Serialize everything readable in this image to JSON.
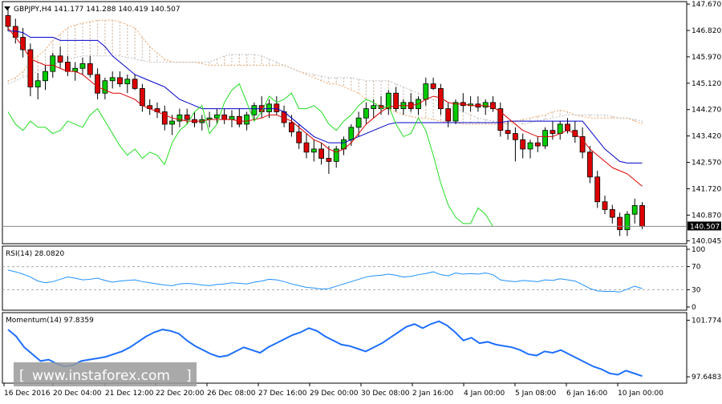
{
  "chart_data": {
    "type": "candlestick",
    "symbol_header": "GBPJPY,H4  141.177 141.288 140.419 140.507",
    "price_axis": {
      "ticks": [
        "147.670",
        "146.820",
        "145.970",
        "145.120",
        "144.270",
        "143.420",
        "142.570",
        "141.720",
        "140.870",
        "140.045"
      ],
      "current_price": "140.507",
      "ylim": [
        139.95,
        147.75
      ]
    },
    "x_labels": [
      "16 Dec 2016",
      "20 Dec 04:00",
      "21 Dec 12:00",
      "22 Dec 20:00",
      "26 Dec 08:00",
      "27 Dec 16:00",
      "29 Dec 00:00",
      "30 Dec 08:00",
      "2 Jan 16:00",
      "4 Jan 00:00",
      "5 Jan 08:00",
      "6 Jan 16:00",
      "10 Jan 00:00"
    ],
    "candles": [
      [
        147.3,
        147.55,
        146.8,
        146.95
      ],
      [
        146.95,
        147.2,
        146.4,
        146.6
      ],
      [
        146.6,
        146.9,
        145.95,
        146.2
      ],
      [
        146.2,
        146.4,
        144.7,
        145.0
      ],
      [
        145.0,
        145.45,
        144.6,
        145.2
      ],
      [
        145.2,
        145.7,
        144.9,
        145.5
      ],
      [
        145.5,
        146.1,
        145.3,
        146.0
      ],
      [
        146.0,
        146.3,
        145.6,
        145.8
      ],
      [
        145.8,
        146.0,
        145.35,
        145.5
      ],
      [
        145.5,
        145.8,
        145.2,
        145.6
      ],
      [
        145.6,
        145.95,
        145.4,
        145.75
      ],
      [
        145.75,
        146.0,
        145.3,
        145.4
      ],
      [
        145.4,
        145.6,
        144.6,
        144.8
      ],
      [
        144.8,
        145.3,
        144.6,
        145.2
      ],
      [
        145.2,
        145.5,
        144.95,
        145.3
      ],
      [
        145.3,
        145.5,
        145.0,
        145.1
      ],
      [
        145.1,
        145.4,
        144.8,
        145.25
      ],
      [
        145.25,
        145.4,
        144.9,
        144.95
      ],
      [
        144.95,
        145.1,
        144.2,
        144.4
      ],
      [
        144.4,
        144.6,
        144.1,
        144.3
      ],
      [
        144.3,
        144.5,
        144.0,
        144.2
      ],
      [
        144.2,
        144.4,
        143.6,
        143.8
      ],
      [
        143.8,
        144.1,
        143.45,
        143.9
      ],
      [
        143.9,
        144.3,
        143.7,
        144.1
      ],
      [
        144.1,
        144.3,
        143.8,
        143.95
      ],
      [
        143.95,
        144.2,
        143.7,
        143.85
      ],
      [
        143.85,
        144.1,
        143.6,
        143.95
      ],
      [
        143.95,
        144.2,
        143.7,
        144.0
      ],
      [
        144.0,
        144.3,
        143.8,
        144.1
      ],
      [
        144.1,
        144.3,
        143.8,
        143.95
      ],
      [
        143.95,
        144.25,
        143.7,
        144.05
      ],
      [
        144.05,
        144.3,
        143.7,
        143.8
      ],
      [
        143.8,
        144.2,
        143.6,
        144.1
      ],
      [
        144.1,
        144.5,
        143.9,
        144.4
      ],
      [
        144.4,
        144.7,
        144.0,
        144.2
      ],
      [
        144.2,
        144.6,
        144.0,
        144.45
      ],
      [
        144.45,
        144.7,
        144.1,
        144.2
      ],
      [
        144.2,
        144.4,
        143.7,
        143.85
      ],
      [
        143.85,
        144.1,
        143.4,
        143.55
      ],
      [
        143.55,
        143.8,
        143.0,
        143.2
      ],
      [
        143.2,
        143.5,
        142.7,
        142.9
      ],
      [
        142.9,
        143.3,
        142.6,
        143.0
      ],
      [
        143.0,
        143.2,
        142.5,
        142.7
      ],
      [
        142.7,
        143.1,
        142.2,
        142.6
      ],
      [
        142.6,
        143.1,
        142.4,
        143.0
      ],
      [
        143.0,
        143.4,
        142.8,
        143.3
      ],
      [
        143.3,
        143.8,
        143.1,
        143.7
      ],
      [
        143.7,
        144.2,
        143.4,
        144.0
      ],
      [
        144.0,
        144.5,
        143.8,
        144.3
      ],
      [
        144.3,
        144.6,
        144.0,
        144.4
      ],
      [
        144.4,
        144.7,
        144.1,
        144.3
      ],
      [
        144.3,
        144.9,
        144.1,
        144.8
      ],
      [
        144.8,
        145.0,
        144.2,
        144.3
      ],
      [
        144.3,
        144.6,
        144.1,
        144.5
      ],
      [
        144.5,
        144.8,
        144.2,
        144.3
      ],
      [
        144.3,
        144.7,
        144.1,
        144.6
      ],
      [
        144.6,
        145.3,
        144.4,
        145.1
      ],
      [
        145.1,
        145.3,
        144.9,
        144.95
      ],
      [
        144.95,
        145.1,
        144.1,
        144.3
      ],
      [
        144.3,
        144.5,
        143.7,
        143.9
      ],
      [
        143.9,
        144.6,
        143.8,
        144.5
      ],
      [
        144.5,
        144.8,
        144.2,
        144.4
      ],
      [
        144.4,
        144.7,
        144.2,
        144.45
      ],
      [
        144.45,
        144.7,
        144.2,
        144.35
      ],
      [
        144.35,
        144.6,
        144.1,
        144.5
      ],
      [
        144.5,
        144.7,
        144.2,
        144.3
      ],
      [
        144.3,
        144.5,
        143.4,
        143.6
      ],
      [
        143.6,
        143.9,
        143.3,
        143.5
      ],
      [
        143.5,
        143.7,
        142.6,
        143.3
      ],
      [
        143.3,
        143.5,
        142.7,
        143.0
      ],
      [
        143.0,
        143.3,
        142.7,
        143.2
      ],
      [
        143.2,
        143.4,
        142.9,
        143.1
      ],
      [
        143.1,
        143.7,
        143.0,
        143.6
      ],
      [
        143.6,
        143.9,
        143.3,
        143.5
      ],
      [
        143.5,
        143.9,
        143.3,
        143.8
      ],
      [
        143.8,
        144.0,
        143.5,
        143.6
      ],
      [
        143.6,
        143.9,
        143.2,
        143.4
      ],
      [
        143.4,
        143.7,
        142.7,
        142.9
      ],
      [
        142.9,
        143.1,
        141.9,
        142.1
      ],
      [
        142.1,
        142.3,
        141.1,
        141.3
      ],
      [
        141.3,
        141.5,
        140.9,
        141.05
      ],
      [
        141.05,
        141.2,
        140.6,
        140.8
      ],
      [
        140.8,
        140.95,
        140.2,
        140.4
      ],
      [
        140.4,
        141.0,
        140.2,
        140.9
      ],
      [
        140.9,
        141.4,
        140.6,
        141.18
      ],
      [
        141.18,
        141.29,
        140.42,
        140.51
      ]
    ],
    "tenkan": [
      146.9,
      146.6,
      146.3,
      145.9,
      145.8,
      145.7,
      145.7,
      145.6,
      145.5,
      145.5,
      145.4,
      145.2,
      145.0,
      144.9,
      144.8,
      144.8,
      144.7,
      144.6,
      144.4,
      144.3,
      144.2,
      144.1,
      144.0,
      143.95,
      143.9,
      143.9,
      143.9,
      143.95,
      143.95,
      143.95,
      143.95,
      143.9,
      143.9,
      143.95,
      144.0,
      144.1,
      144.1,
      144.0,
      143.9,
      143.7,
      143.5,
      143.3,
      143.2,
      143.0,
      142.9,
      143.0,
      143.2,
      143.5,
      143.8,
      144.0,
      144.2,
      144.35,
      144.4,
      144.4,
      144.4,
      144.45,
      144.6,
      144.7,
      144.65,
      144.5,
      144.45,
      144.45,
      144.4,
      144.4,
      144.4,
      144.35,
      144.2,
      144.0,
      143.8,
      143.6,
      143.5,
      143.4,
      143.4,
      143.4,
      143.5,
      143.6,
      143.5,
      143.3,
      143.0,
      142.8,
      142.6,
      142.4,
      142.3,
      142.2,
      142.0,
      141.8
    ],
    "kijun": [
      146.8,
      146.8,
      146.75,
      146.6,
      146.6,
      146.6,
      146.6,
      146.5,
      146.5,
      146.5,
      146.5,
      146.5,
      146.5,
      146.3,
      146.0,
      145.8,
      145.6,
      145.4,
      145.3,
      145.2,
      145.1,
      145.0,
      144.8,
      144.6,
      144.5,
      144.4,
      144.3,
      144.3,
      144.3,
      144.3,
      144.3,
      144.3,
      144.3,
      144.3,
      144.3,
      144.3,
      144.3,
      144.2,
      144.0,
      143.8,
      143.6,
      143.4,
      143.3,
      143.2,
      143.2,
      143.2,
      143.3,
      143.4,
      143.5,
      143.6,
      143.7,
      143.8,
      143.85,
      143.85,
      143.85,
      143.85,
      143.85,
      143.85,
      143.85,
      143.85,
      143.85,
      143.85,
      143.85,
      143.85,
      143.85,
      143.85,
      143.85,
      143.9,
      143.9,
      143.9,
      143.9,
      143.9,
      143.9,
      143.9,
      143.9,
      143.9,
      143.9,
      143.9,
      143.6,
      143.3,
      143.0,
      142.8,
      142.6,
      142.55,
      142.55,
      142.55
    ],
    "chikou": [
      144.2,
      143.8,
      143.6,
      143.9,
      143.7,
      143.7,
      143.5,
      143.6,
      143.9,
      143.8,
      143.7,
      144.1,
      144.3,
      143.9,
      143.5,
      143.1,
      142.8,
      143.0,
      142.7,
      142.9,
      142.8,
      142.5,
      143.2,
      143.6,
      143.8,
      144.2,
      144.4,
      143.5,
      143.8,
      144.5,
      144.9,
      145.1,
      144.5,
      143.9,
      144.2,
      144.7,
      144.5,
      144.6,
      144.8,
      144.3,
      144.3,
      144.4,
      144.2,
      143.8,
      143.6,
      143.9,
      144.1,
      144.4,
      144.6,
      144.5,
      144.3,
      144.4,
      143.8,
      143.4,
      143.5,
      144.0,
      143.6,
      142.8,
      141.9,
      141.2,
      140.8,
      140.6,
      140.6,
      141.1,
      140.9,
      140.5
    ],
    "span_a": [
      145.2,
      145.3,
      145.5,
      145.8,
      146.0,
      146.2,
      146.5,
      146.7,
      146.9,
      147.0,
      147.05,
      147.1,
      147.15,
      147.15,
      147.15,
      147.1,
      147.0,
      146.9,
      146.6,
      146.3,
      146.1,
      145.9,
      145.8,
      145.8,
      145.8,
      145.8,
      145.75,
      145.7,
      145.7,
      145.7,
      145.7,
      145.7,
      145.7,
      145.7,
      145.7,
      145.7,
      145.7,
      145.7,
      145.6,
      145.5,
      145.4,
      145.3,
      145.2,
      145.1,
      145.1,
      145.0,
      144.9,
      144.8,
      144.6,
      144.5,
      144.4,
      144.3,
      144.2,
      144.1,
      144.05,
      144.0,
      144.0,
      143.95,
      143.9,
      143.85,
      143.85,
      143.8,
      143.8,
      143.8,
      143.8,
      143.8,
      143.8,
      143.85,
      143.9,
      143.95,
      144.0,
      144.05,
      144.1,
      144.2,
      144.25,
      144.2,
      144.1,
      144.05,
      144.0,
      144.0,
      144.0,
      144.0,
      144.0,
      144.0,
      143.9,
      143.8
    ],
    "span_b": [
      145.1,
      145.2,
      145.3,
      145.4,
      145.5,
      145.6,
      145.7,
      145.8,
      145.9,
      145.95,
      146.0,
      146.0,
      146.0,
      146.0,
      146.0,
      146.0,
      145.95,
      145.9,
      145.85,
      145.8,
      145.8,
      145.8,
      145.8,
      145.8,
      145.8,
      145.8,
      145.8,
      145.8,
      145.9,
      146.0,
      146.05,
      146.05,
      146.05,
      146.05,
      146.0,
      145.9,
      145.8,
      145.7,
      145.6,
      145.5,
      145.45,
      145.4,
      145.35,
      145.3,
      145.3,
      145.3,
      145.3,
      145.25,
      145.2,
      145.2,
      145.2,
      145.2,
      145.1,
      145.0,
      144.9,
      144.8,
      144.7,
      144.6,
      144.5,
      144.4,
      144.3,
      144.2,
      144.1,
      144.0,
      143.95,
      143.9,
      143.85,
      143.8,
      143.8,
      143.8,
      143.85,
      143.9,
      143.95,
      144.0,
      144.05,
      144.1,
      144.1,
      144.1,
      144.1,
      144.1,
      144.1,
      144.05,
      144.0,
      144.0,
      143.95,
      143.9
    ],
    "rsi_header": "RSI(14) 28.0820",
    "rsi_axis": {
      "ticks": [
        "100",
        "70",
        "30",
        "0"
      ],
      "levels": [
        100,
        70,
        30,
        0
      ]
    },
    "rsi": [
      64,
      61,
      57,
      52,
      45,
      42,
      44,
      48,
      52,
      50,
      47,
      48,
      50,
      46,
      43,
      45,
      46,
      47,
      44,
      42,
      40,
      38,
      37,
      40,
      41,
      40,
      38,
      37,
      39,
      40,
      42,
      41,
      40,
      43,
      45,
      48,
      47,
      44,
      40,
      37,
      34,
      33,
      31,
      32,
      36,
      40,
      44,
      48,
      52,
      54,
      55,
      57,
      55,
      52,
      53,
      56,
      58,
      61,
      56,
      54,
      59,
      57,
      58,
      57,
      59,
      56,
      47,
      45,
      44,
      46,
      45,
      44,
      47,
      46,
      49,
      47,
      45,
      39,
      32,
      28,
      27,
      27,
      26,
      31,
      36,
      32
    ],
    "momentum_header": "Momentum(14) 97.8359",
    "momentum_axis": {
      "ticks": [
        "101.7748",
        "97.6483"
      ],
      "ylim": [
        97.3,
        102.1
      ]
    },
    "momentum": [
      101.1,
      100.6,
      99.8,
      99.3,
      98.8,
      98.9,
      98.6,
      98.4,
      98.5,
      98.8,
      98.9,
      99.0,
      99.1,
      99.3,
      99.5,
      99.8,
      100.2,
      100.6,
      100.9,
      101.1,
      101.0,
      100.8,
      100.3,
      99.9,
      99.6,
      99.3,
      99.1,
      99.2,
      99.5,
      99.8,
      99.6,
      99.4,
      99.8,
      100.1,
      100.4,
      100.7,
      100.9,
      101.2,
      101.0,
      100.6,
      100.3,
      100.0,
      99.9,
      99.7,
      99.5,
      99.8,
      100.1,
      100.5,
      100.9,
      101.3,
      101.5,
      101.2,
      101.5,
      101.7,
      101.4,
      100.9,
      100.3,
      100.5,
      100.1,
      100.2,
      100.0,
      99.9,
      99.8,
      99.6,
      99.3,
      99.2,
      99.5,
      99.4,
      99.6,
      99.3,
      99.0,
      98.7,
      98.4,
      98.2,
      97.9,
      97.8,
      98.1,
      97.9,
      97.7
    ],
    "colors": {
      "bull_candle": "#00cc00",
      "bear_candle": "#dd0000",
      "wick": "#000000",
      "tenkan": "#dd0000",
      "kijun": "#0000cc",
      "chikou": "#22dd22",
      "span_a": "#f4a460",
      "span_b": "#c0c0c0",
      "rsi_line": "#1e90ff",
      "momentum_line": "#1e6fff",
      "level_line": "#aaaaaa"
    }
  },
  "watermark": {
    "text": "www.instaforex.com",
    "brackets": "[ ]"
  }
}
